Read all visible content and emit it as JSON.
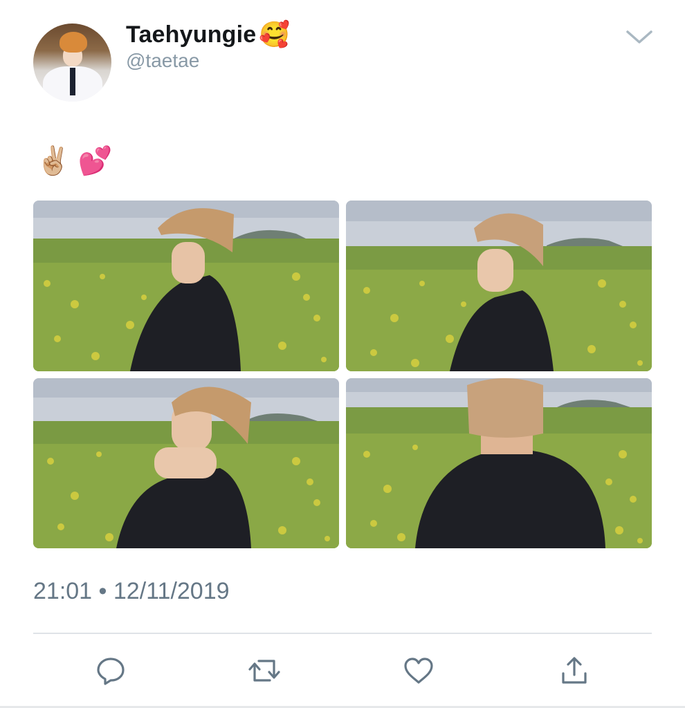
{
  "user": {
    "display_name": "Taehyungie",
    "name_emoji": "🥰",
    "handle": "@taetae"
  },
  "tweet": {
    "text": "✌🏼 💕",
    "timestamp": "21:01 • 12/11/2019"
  },
  "icons": {
    "menu": "chevron-down-icon",
    "reply": "reply-icon",
    "retweet": "retweet-icon",
    "like": "heart-icon",
    "share": "share-icon"
  },
  "colors": {
    "text": "#14171a",
    "secondary": "#657786",
    "handle": "#8899a6",
    "divider": "#dfe3e7",
    "icon": "#657786"
  }
}
